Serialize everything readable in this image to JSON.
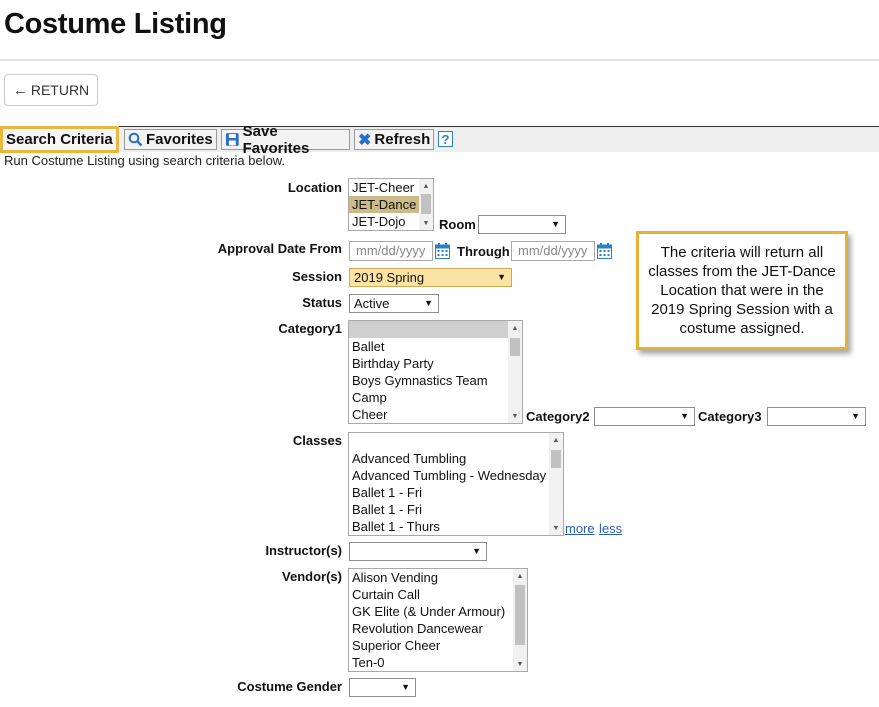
{
  "page_title": "Costume Listing",
  "return_label": "RETURN",
  "toolbar": {
    "search_criteria": "Search Criteria",
    "favorites": "Favorites",
    "save_favorites": "Save Favorites",
    "refresh": "Refresh",
    "help": "?"
  },
  "intro": "Run Costume Listing using search criteria below.",
  "location": {
    "label": "Location",
    "options": [
      "JET-Cheer",
      "JET-Dance",
      "JET-Dojo"
    ],
    "selected": "JET-Dance"
  },
  "room": {
    "label": "Room",
    "value": ""
  },
  "approval_date": {
    "label": "Approval Date From",
    "from_placeholder": "mm/dd/yyyy",
    "through_label": "Through",
    "through_placeholder": "mm/dd/yyyy"
  },
  "session": {
    "label": "Session",
    "value": "2019 Spring"
  },
  "status": {
    "label": "Status",
    "value": "Active"
  },
  "category1": {
    "label": "Category1",
    "options": [
      "",
      "Ballet",
      "Birthday Party",
      "Boys Gymnastics Team",
      "Camp",
      "Cheer"
    ]
  },
  "category2": {
    "label": "Category2",
    "value": ""
  },
  "category3": {
    "label": "Category3",
    "value": ""
  },
  "classes": {
    "label": "Classes",
    "options": [
      "",
      "Advanced Tumbling",
      "Advanced Tumbling - Wednesday",
      "Ballet 1 - Fri",
      "Ballet 1 - Fri",
      "Ballet 1 - Thurs"
    ],
    "more": "more",
    "less": "less"
  },
  "instructors": {
    "label": "Instructor(s)",
    "value": ""
  },
  "vendors": {
    "label": "Vendor(s)",
    "options": [
      "Alison Vending",
      "Curtain Call",
      "GK Elite (& Under Armour)",
      "Revolution Dancewear",
      "Superior Cheer",
      "Ten-0"
    ]
  },
  "costume_gender": {
    "label": "Costume Gender",
    "value": ""
  },
  "callout": "The criteria will return all classes from the JET-Dance Location that were in the 2019 Spring Session with a costume assigned.",
  "colors": {
    "highlight": "#e9b83a",
    "link": "#2a5fb0",
    "selected_option": "#ccbb88",
    "session_bg": "#fbe3a4"
  }
}
